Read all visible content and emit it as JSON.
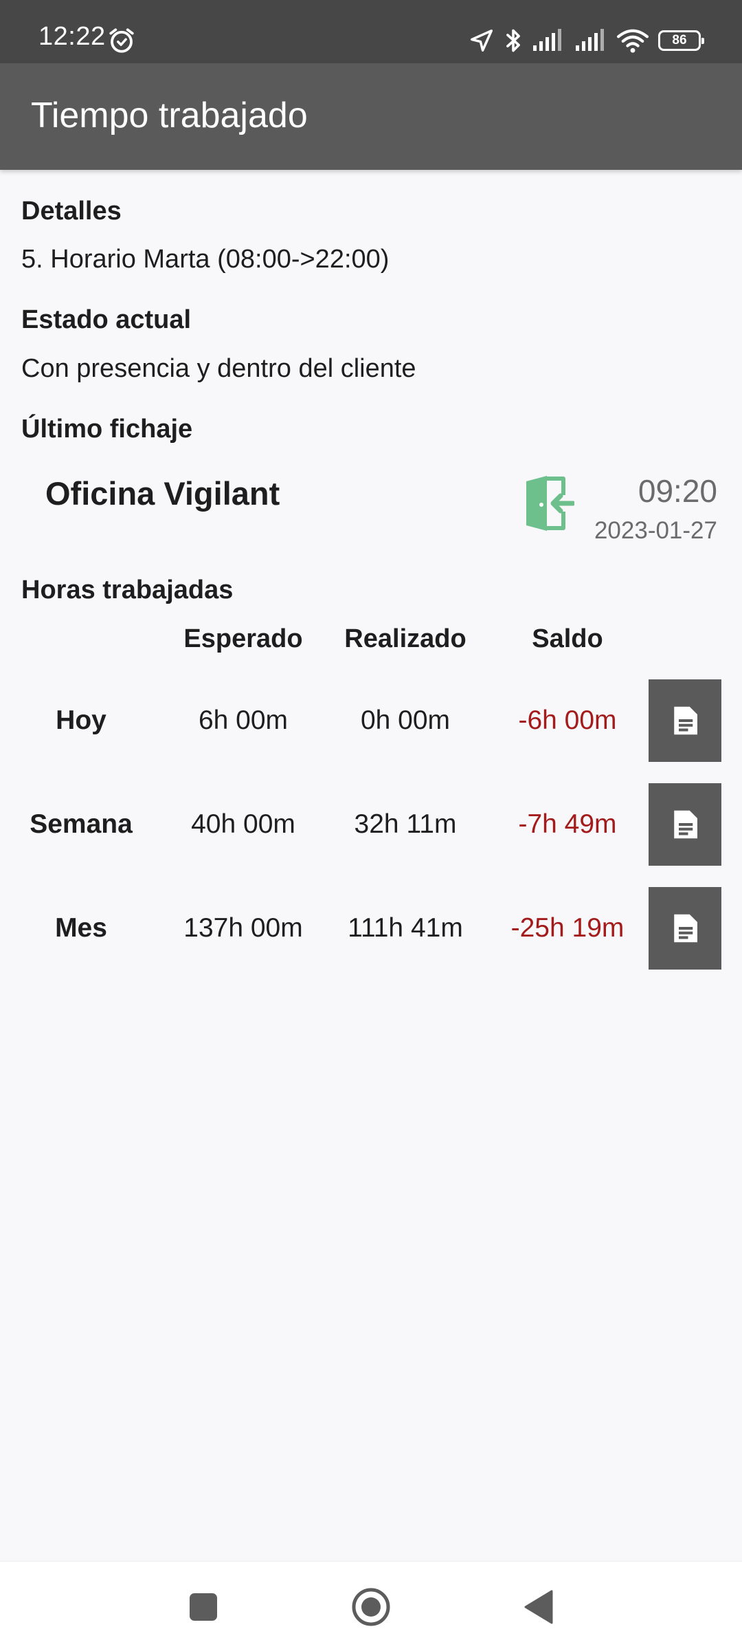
{
  "status_bar": {
    "time": "12:22",
    "battery": "86",
    "icons": [
      "alarm-icon",
      "location-arrow-icon",
      "bluetooth-icon",
      "signal-icon",
      "signal-icon",
      "wifi-icon",
      "battery-icon"
    ]
  },
  "app_bar": {
    "title": "Tiempo trabajado"
  },
  "details": {
    "label": "Detalles",
    "value": "5. Horario Marta (08:00->22:00)"
  },
  "current_state": {
    "label": "Estado actual",
    "value": "Con presencia y dentro del cliente"
  },
  "last_check": {
    "label": "Último fichaje",
    "location": "Oficina Vigilant",
    "time": "09:20",
    "date": "2023-01-27",
    "icon": "door-enter-icon",
    "icon_color": "#6dbf8b"
  },
  "hours": {
    "label": "Horas trabajadas",
    "columns": [
      "Esperado",
      "Realizado",
      "Saldo"
    ],
    "rows": [
      {
        "label": "Hoy",
        "expected": "6h 00m",
        "done": "0h 00m",
        "balance": "-6h 00m"
      },
      {
        "label": "Semana",
        "expected": "40h 00m",
        "done": "32h 11m",
        "balance": "-7h 49m"
      },
      {
        "label": "Mes",
        "expected": "137h 00m",
        "done": "111h 41m",
        "balance": "-25h 19m"
      }
    ],
    "row_icon": "document-icon"
  },
  "colors": {
    "status_bar": "#474747",
    "app_bar": "#5a5a5a",
    "negative_balance": "#a31b1b",
    "background": "#f8f7f9"
  },
  "nav_bar": {
    "icons": [
      "recent-apps-icon",
      "home-icon",
      "back-icon"
    ]
  }
}
